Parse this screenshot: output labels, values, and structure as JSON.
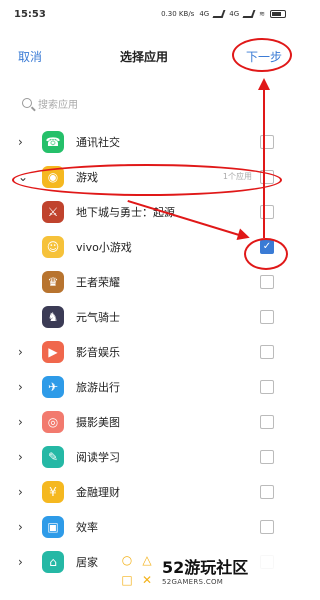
{
  "status": {
    "time": "15:53",
    "net_speed": "0.30 KB/s",
    "net1": "4G",
    "net2": "4G"
  },
  "header": {
    "cancel": "取消",
    "title": "选择应用",
    "next": "下一步"
  },
  "search": {
    "placeholder": "搜索应用"
  },
  "rows": [
    {
      "label": "通讯社交",
      "count": "",
      "icon": "phone-icon",
      "color": "#25c06a",
      "glyph": "☎",
      "type": "category",
      "checked": false
    },
    {
      "label": "游戏",
      "count": "1个应用",
      "icon": "gamepad-icon",
      "color": "#f5b820",
      "glyph": "◉",
      "type": "category-open",
      "checked": false
    },
    {
      "label": "地下城与勇士：起源",
      "count": "",
      "icon": "game-dnf-icon",
      "color": "#c0432d",
      "glyph": "⚔",
      "type": "child",
      "checked": false
    },
    {
      "label": "vivo小游戏",
      "count": "",
      "icon": "vivo-minigame-icon",
      "color": "#f6c23a",
      "glyph": "☺",
      "type": "child",
      "checked": true
    },
    {
      "label": "王者荣耀",
      "count": "",
      "icon": "game-honor-icon",
      "color": "#b8742f",
      "glyph": "♛",
      "type": "child",
      "checked": false
    },
    {
      "label": "元气骑士",
      "count": "",
      "icon": "game-knight-icon",
      "color": "#3b3b55",
      "glyph": "♞",
      "type": "child",
      "checked": false
    },
    {
      "label": "影音娱乐",
      "count": "",
      "icon": "video-icon",
      "color": "#f0674c",
      "glyph": "▶",
      "type": "category",
      "checked": false
    },
    {
      "label": "旅游出行",
      "count": "",
      "icon": "plane-icon",
      "color": "#2e9be8",
      "glyph": "✈",
      "type": "category",
      "checked": false
    },
    {
      "label": "摄影美图",
      "count": "",
      "icon": "camera-icon",
      "color": "#f27a6e",
      "glyph": "◎",
      "type": "category",
      "checked": false
    },
    {
      "label": "阅读学习",
      "count": "",
      "icon": "education-icon",
      "color": "#25b8a5",
      "glyph": "✎",
      "type": "category",
      "checked": false
    },
    {
      "label": "金融理财",
      "count": "",
      "icon": "finance-icon",
      "color": "#f5b820",
      "glyph": "¥",
      "type": "category",
      "checked": false
    },
    {
      "label": "效率",
      "count": "",
      "icon": "briefcase-icon",
      "color": "#2e9be8",
      "glyph": "▣",
      "type": "category",
      "checked": false
    },
    {
      "label": "居家",
      "count": "",
      "icon": "cart-icon",
      "color": "#25b8a5",
      "glyph": "⌂",
      "type": "category",
      "checked": false
    }
  ],
  "watermark": {
    "main": "52游玩社区",
    "sub": "52GAMERS.COM"
  }
}
